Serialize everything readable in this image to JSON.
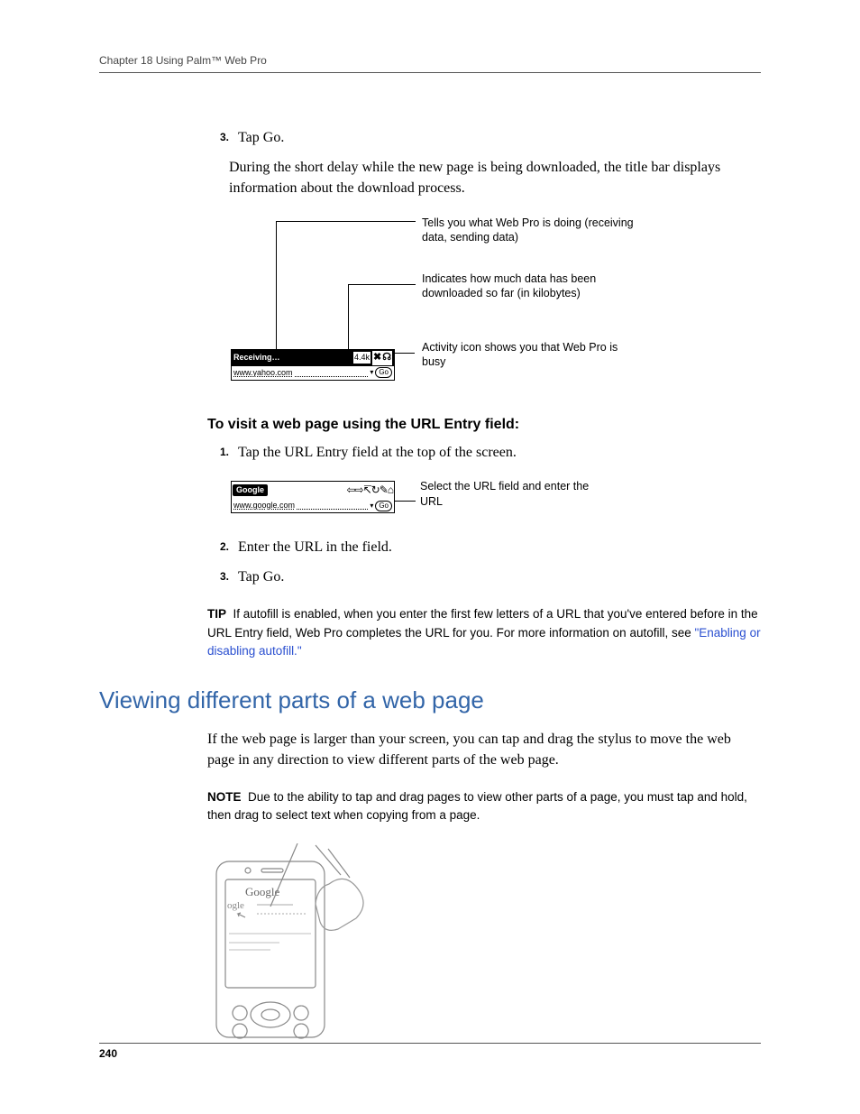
{
  "header": {
    "text": "Chapter 18   Using Palm™ Web Pro"
  },
  "step3": {
    "num": "3.",
    "text": "Tap Go."
  },
  "para1": "During the short delay while the new page is being downloaded, the title bar displays information about the download process.",
  "fig1": {
    "status": "Receiving…",
    "kb": "4.4k",
    "url": "www.yahoo.com",
    "go": "Go",
    "callout1": "Tells you what Web Pro is doing (receiving data, sending data)",
    "callout2": "Indicates how much data has been downloaded so far (in kilobytes)",
    "callout3": "Activity icon shows you that Web Pro is busy"
  },
  "subhead": "To visit a web page using the URL Entry field:",
  "stepA": {
    "num": "1.",
    "text": "Tap the URL Entry field at the top of the screen."
  },
  "fig2": {
    "title": "Google",
    "url": "www.google.com",
    "go": "Go",
    "callout": "Select the URL field and enter the URL"
  },
  "stepB": {
    "num": "2.",
    "text": "Enter the URL in the field."
  },
  "stepC": {
    "num": "3.",
    "text": "Tap Go."
  },
  "tip": {
    "label": "TIP",
    "body_before": "If autofill is enabled, when you enter the first few letters of a URL that you've entered before in the URL Entry field, Web Pro completes the URL for you. For more information on autofill, see ",
    "link": "\"Enabling or disabling autofill.\""
  },
  "h2": "Viewing different parts of a web page",
  "para2": "If the web page is larger than your screen, you can tap and drag the stylus to move the web page in any direction to view different parts of the web page.",
  "note": {
    "label": "NOTE",
    "body": "Due to the ability to tap and drag pages to view other parts of a page, you must tap and hold, then drag to select text when copying from a page."
  },
  "device_label": "Google",
  "page_number": "240"
}
